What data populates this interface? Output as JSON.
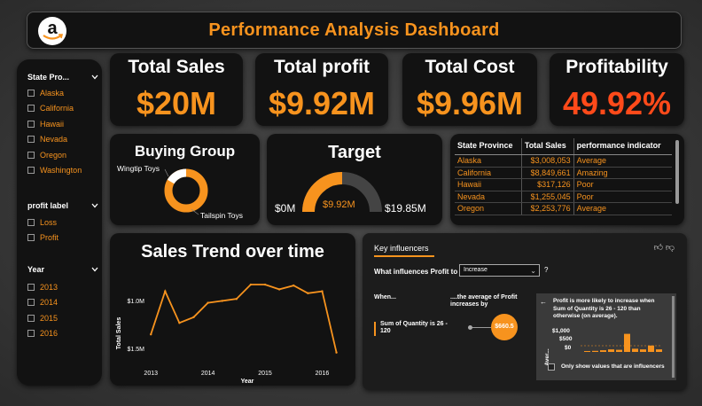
{
  "header": {
    "title": "Performance Analysis Dashboard",
    "logo_icon": "amazon-logo-icon"
  },
  "slicers": {
    "state": {
      "title": "State Pro...",
      "items": [
        "Alaska",
        "California",
        "Hawaii",
        "Nevada",
        "Oregon",
        "Washington"
      ]
    },
    "profit_label": {
      "title": "profit label",
      "items": [
        "Loss",
        "Profit"
      ]
    },
    "year": {
      "title": "Year",
      "items": [
        "2013",
        "2014",
        "2015",
        "2016"
      ]
    }
  },
  "kpis": {
    "total_sales": {
      "label": "Total Sales",
      "value": "$20M"
    },
    "total_profit": {
      "label": "Total profit",
      "value": "$9.92M"
    },
    "total_cost": {
      "label": "Total Cost",
      "value": "$9.96M"
    },
    "profitability": {
      "label": "Profitability",
      "value": "49.92%"
    }
  },
  "buying_group": {
    "title": "Buying Group",
    "labels": [
      "Wingtip Toys",
      "Tailspin Toys"
    ]
  },
  "target": {
    "title": "Target",
    "min_label": "$0M",
    "max_label": "$19.85M",
    "value_label": "$9.92M",
    "fraction": 0.5
  },
  "table": {
    "headers": [
      "State Province",
      "Total Sales",
      "performance indicator"
    ],
    "rows": [
      [
        "Alaska",
        "$3,008,053",
        "Average"
      ],
      [
        "California",
        "$8,849,661",
        "Amazing"
      ],
      [
        "Hawaii",
        "$317,126",
        "Poor"
      ],
      [
        "Nevada",
        "$1,255,045",
        "Poor"
      ],
      [
        "Oregon",
        "$2,253,776",
        "Average"
      ]
    ]
  },
  "trend": {
    "title": "Sales Trend over time",
    "ylabel": "Total Sales",
    "xlabel": "Year",
    "ytick_labels": [
      "$1.5M",
      "$1.0M"
    ],
    "xtick_labels": [
      "2013",
      "2014",
      "2015",
      "2016"
    ]
  },
  "chart_data": {
    "type": "line",
    "title": "Sales Trend over time",
    "xlabel": "Year",
    "ylabel": "Total Sales",
    "x": [
      2013.0,
      2013.25,
      2013.5,
      2013.75,
      2014.0,
      2014.25,
      2014.5,
      2014.75,
      2015.0,
      2015.25,
      2015.5,
      2015.75,
      2016.0,
      2016.25
    ],
    "values": [
      1.15,
      1.6,
      1.27,
      1.33,
      1.48,
      1.5,
      1.52,
      1.67,
      1.67,
      1.62,
      1.66,
      1.58,
      1.6,
      0.96
    ],
    "ylim": [
      0.8,
      1.8
    ],
    "xlim": [
      2012.95,
      2016.35
    ],
    "yticks": [
      1.0,
      1.5
    ],
    "xticks": [
      2013,
      2014,
      2015,
      2016
    ]
  },
  "key_influencers": {
    "tab_label": "Key influencers",
    "question": "What influences Profit to",
    "select_value": "Increase",
    "qmark": "?",
    "when_label": "When...",
    "avg_label": "....the average of Profit increases by",
    "condition": "Sum of Quantity is 26 - 120",
    "bubble_value": "$660.5",
    "detail_text": "Profit is more likely to increase when Sum of Quantity is 26 - 120 than otherwise (on average).",
    "mini_ticks": [
      "$1,000",
      "$500",
      "$0"
    ],
    "mini_axis_label": "Aver...",
    "checkbox_label": "Only show values that are influencers",
    "mini_values": [
      0,
      0.05,
      0.08,
      0.12,
      0.1,
      0.85,
      0.15,
      0.12,
      0.3,
      0.12
    ]
  },
  "colors": {
    "accent": "#f7931e",
    "alert": "#ff4a1a",
    "panel": "#121212"
  }
}
